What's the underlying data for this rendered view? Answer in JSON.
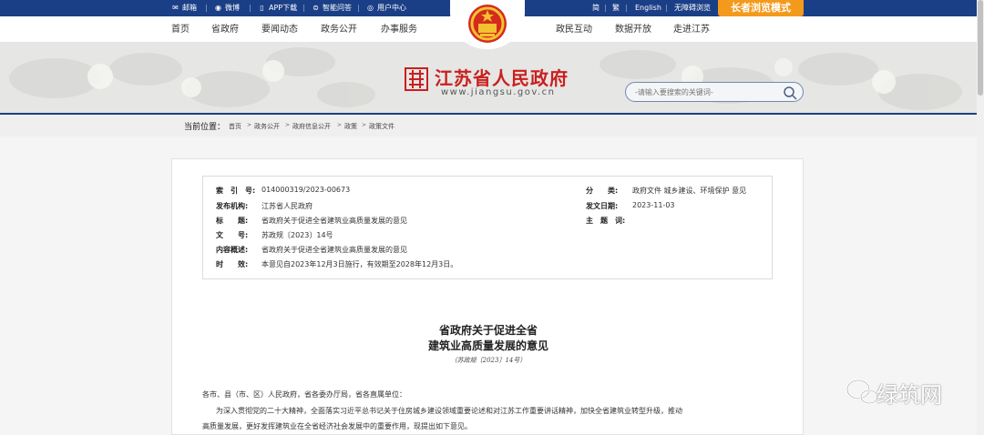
{
  "topbar": {
    "mail": "邮箱",
    "weibo": "微博",
    "app": "APP下载",
    "ai": "智能问答",
    "login": "用户中心",
    "lang1": "简",
    "lang2": "繁",
    "lang3": "English",
    "accessible": "无障碍浏览",
    "elder_mode": "长者浏览模式"
  },
  "nav": {
    "left": [
      "首页",
      "省政府",
      "要闻动态",
      "政务公开",
      "办事服务"
    ],
    "right": [
      "政民互动",
      "数据开放",
      "走进江苏"
    ]
  },
  "brand": {
    "name": "江苏省人民政府",
    "url": "www.jiangsu.gov.cn"
  },
  "search": {
    "placeholder": "-请输入要搜索的关键词-"
  },
  "breadcrumb": {
    "label": "当前位置：",
    "items": [
      "首页",
      "政务公开",
      "政府信息公开",
      "政策",
      "政策文件"
    ]
  },
  "meta": {
    "index_label": "索　引　号:",
    "index_value": "014000319/2023-00673",
    "issuer_label": "发布机构:",
    "issuer_value": "江苏省人民政府",
    "title_label": "标　　题:",
    "title_value": "省政府关于促进全省建筑业高质量发展的意见",
    "docno_label": "文　　号:",
    "docno_value": "苏政规〔2023〕14号",
    "summary_label": "内容概述:",
    "summary_value": "省政府关于促进全省建筑业高质量发展的意见",
    "validity_label": "时　　效:",
    "validity_value": "本意见自2023年12月3日施行，有效期至2028年12月3日。",
    "category_label": "分　　类:",
    "category_value": "政府文件 城乡建设、环境保护 意见",
    "date_label": "发文日期:",
    "date_value": "2023-11-03",
    "subject_label": "主　题　词:",
    "subject_value": ""
  },
  "document": {
    "title_line1": "省政府关于促进全省",
    "title_line2": "建筑业高质量发展的意见",
    "doc_number": "（苏政规〔2023〕14号）",
    "salutation": "各市、县（市、区）人民政府，省各委办厅局，省各直属单位：",
    "para1_line1": "为深入贯彻党的二十大精神，全面落实习近平总书记关于住房城乡建设领域重要论述和对江苏工作重要讲话精神，加快全省建筑业转型升级，推动",
    "para1_line2": "高质量发展，更好发挥建筑业在全省经济社会发展中的重要作用，现提出如下意见。"
  },
  "watermark": {
    "text": "绿筑网"
  },
  "colors": {
    "topbar": "#1b3f86",
    "elder_button": "#f39a1c",
    "brand_red": "#c8201f"
  }
}
